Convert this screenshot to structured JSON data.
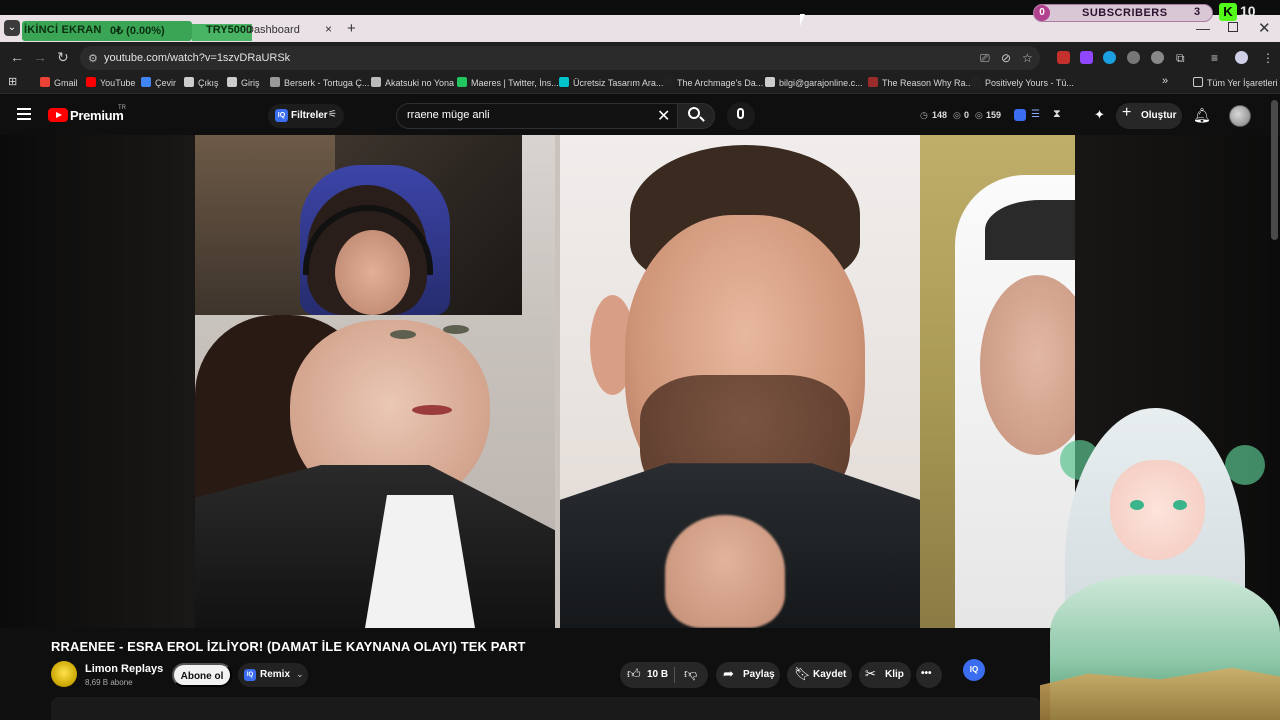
{
  "browser": {
    "tab_title": "Dashboard",
    "tab_close": "×",
    "new_tab": "+",
    "url": "youtube.com/watch?v=1szvDRaURSk",
    "window_min": "—",
    "window_close": "✕",
    "overlay": {
      "screen_label": "İKİNCİ EKRAN",
      "progress": "0₺ (0.00%)",
      "goal": "TRY5000"
    },
    "bookmarks": [
      {
        "label": "Gmail",
        "color": "#ea4335"
      },
      {
        "label": "YouTube",
        "color": "#ff0000"
      },
      {
        "label": "Çevir",
        "color": "#4285f4"
      },
      {
        "label": "Çıkış",
        "color": "#cccccc"
      },
      {
        "label": "Giriş",
        "color": "#cccccc"
      },
      {
        "label": "Berserk - Tortuga Ç...",
        "color": "#999999"
      },
      {
        "label": "Akatsuki no Yona",
        "color": "#bbbbbb"
      },
      {
        "label": "Maeres | Twitter, İns...",
        "color": "#22c55e"
      },
      {
        "label": "Ücretsiz Tasarım Ara...",
        "color": "#00c4cc"
      },
      {
        "label": "The Archmage's Da...",
        "color": "#222222"
      },
      {
        "label": "bilgi@garajonline.c...",
        "color": "#cccccc"
      },
      {
        "label": "The Reason Why Ra...",
        "color": "#9b2c2c"
      },
      {
        "label": "Positively Yours - Tü...",
        "color": "#222222"
      }
    ],
    "bookmarks_more": "»",
    "all_bookmarks": "Tüm Yer İşaretleri"
  },
  "stream_overlay": {
    "subscribers_label": "SUBSCRIBERS",
    "subscribers_start": "0",
    "subscribers_count": "3",
    "kick_count": "10"
  },
  "youtube": {
    "brand": "Premium",
    "region": "TR",
    "filter_label": "Filtreler",
    "search_value": "rraene müge anli",
    "stats": {
      "views": "148",
      "a": "0",
      "b": "159"
    },
    "create_label": "Oluştur",
    "video": {
      "title": "RRAENEE - ESRA EROL İZLİYOR! (DAMAT İLE KAYNANA OLAYI) TEK PART",
      "channel": "Limon Replays",
      "subscribers": "8,69 B abone",
      "subscribe_label": "Abone ol",
      "remix_label": "Remix",
      "likes": "10 B",
      "share_label": "Paylaş",
      "save_label": "Kaydet",
      "clip_label": "Klip",
      "more": "•••"
    }
  },
  "colors": {
    "yt_red": "#ff0000",
    "iq_blue": "#3b6df0",
    "kick_green": "#53fc18",
    "overlay_green": "#3aa655"
  }
}
